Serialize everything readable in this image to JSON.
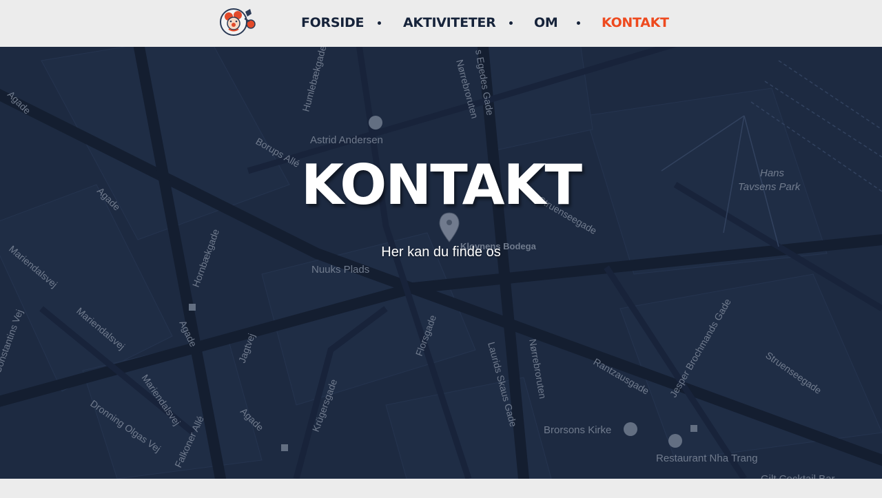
{
  "header": {
    "logo_name": "clown-mascot-logo",
    "nav": [
      {
        "label": "FORSIDE",
        "active": false
      },
      {
        "label": "AKTIVITETER",
        "active": false
      },
      {
        "label": "OM",
        "active": false
      },
      {
        "label": "KONTAKT",
        "active": true
      }
    ],
    "active_color": "#ee4a1f",
    "text_color": "#16233a"
  },
  "hero": {
    "title": "KONTAKT",
    "subtitle": "Her kan du finde os",
    "map": {
      "marker_label": "Klovnens Bodega",
      "streets": [
        "Agade",
        "Borups Allé",
        "Humlebækgade",
        "Hornbækgade",
        "Mariendalsvej",
        "Constantins Vej",
        "Jagtvej",
        "Dronning Olgas Vej",
        "Falkoner Allé",
        "Krügersgade",
        "Florsgade",
        "Laurids Skaus Gade",
        "Nørrebroruten",
        "Rantzausgade",
        "Struenseegade",
        "Jesper Brochmands Gade",
        "Egedes Gade"
      ],
      "places": [
        "Astrid Andersen",
        "Nuuks Plads",
        "Hans Tavsens Park",
        "Brorsons Kirke",
        "Restaurant Nha Trang",
        "Gilt Cocktail Bar"
      ]
    }
  }
}
